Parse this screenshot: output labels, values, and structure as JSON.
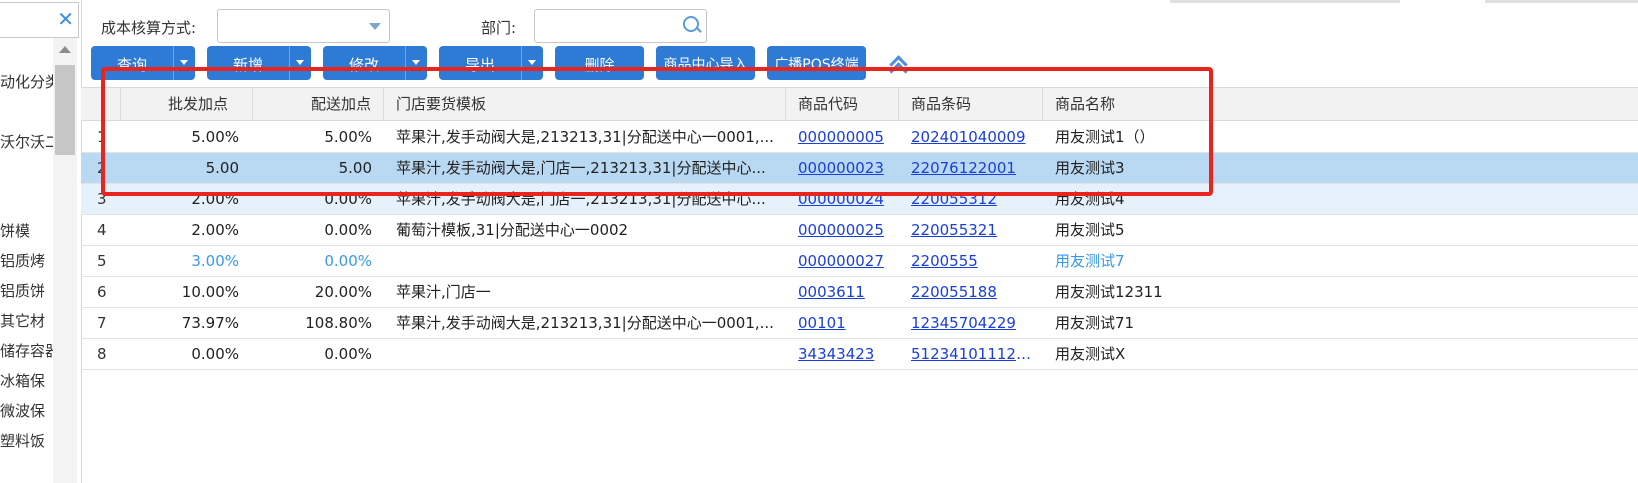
{
  "left_panel": {
    "tree_items": [
      "动化分类",
      "沃尔沃二",
      "饼模",
      "铝质烤",
      "铝质饼",
      "其它材",
      "储存容器",
      "冰箱保",
      "微波保",
      "塑料饭"
    ]
  },
  "filters": {
    "cost_method_label": "成本核算方式:",
    "cost_method_value": "",
    "dept_label": "部门:",
    "dept_value": ""
  },
  "toolbar": {
    "query": "查询",
    "add": "新增",
    "modify": "修改",
    "export": "导出",
    "delete": "删除",
    "import_center": "商品中心导入",
    "broadcast_pos": "广播POS终端"
  },
  "table": {
    "columns": [
      "批发加点",
      "配送加点",
      "门店要货模板",
      "商品代码",
      "商品条码",
      "商品名称"
    ],
    "rows": [
      {
        "no": "1",
        "wholesale": "5.00%",
        "delivery": "5.00%",
        "template": "苹果汁,发手动阀大是,213213,31|分配送中心一0001,...",
        "code": "000000005",
        "barcode": "202401040009",
        "name": "用友测试1（）",
        "style": "normal"
      },
      {
        "no": "2",
        "wholesale": "5.00",
        "delivery": "5.00",
        "template": "苹果汁,发手动阀大是,门店一,213213,31|分配送中心...",
        "code": "000000023",
        "barcode": "22076122001",
        "name": "用友测试3",
        "style": "sel"
      },
      {
        "no": "3",
        "wholesale": "2.00%",
        "delivery": "0.00%",
        "template": "苹果汁,发手动阀大是,门店一,213213,31|分配送中心...",
        "code": "000000024",
        "barcode": "220055312",
        "name": "用友测试4",
        "style": "alt"
      },
      {
        "no": "4",
        "wholesale": "2.00%",
        "delivery": "0.00%",
        "template": "葡萄汁模板,31|分配送中心一0002",
        "code": "000000025",
        "barcode": "220055321",
        "name": "用友测试5",
        "style": "normal"
      },
      {
        "no": "5",
        "wholesale": "3.00%",
        "delivery": "0.00%",
        "template": "",
        "code": "000000027",
        "barcode": "2200555",
        "name": "用友测试7",
        "style": "blue"
      },
      {
        "no": "6",
        "wholesale": "10.00%",
        "delivery": "20.00%",
        "template": "苹果汁,门店一",
        "code": "0003611",
        "barcode": "220055188",
        "name": "用友测试12311",
        "style": "normal"
      },
      {
        "no": "7",
        "wholesale": "73.97%",
        "delivery": "108.80%",
        "template": "苹果汁,发手动阀大是,213213,31|分配送中心一0001,...",
        "code": "00101",
        "barcode": "12345704229",
        "name": "用友测试71",
        "style": "normal"
      },
      {
        "no": "8",
        "wholesale": "0.00%",
        "delivery": "0.00%",
        "template": "",
        "code": "34343423",
        "barcode": "512341011123...",
        "name": "用友测试X",
        "style": "normal"
      }
    ]
  },
  "colors": {
    "button_blue": "#2e7bd6",
    "selected_row": "#b9d8f2",
    "highlight_box": "#e8241c",
    "link": "#1a3fd8"
  }
}
